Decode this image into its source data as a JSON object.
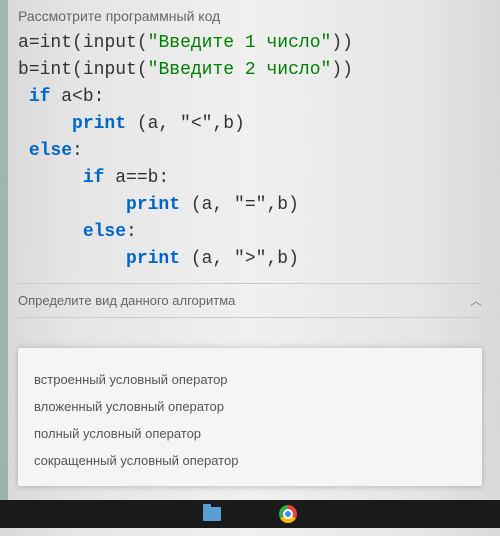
{
  "question": {
    "title": "Рассмотрите программный код",
    "subtitle": "Определите вид данного алгоритма"
  },
  "code": {
    "line1_a": "a",
    "line1_eq": "=",
    "line1_int": "int",
    "line1_p1": "(",
    "line1_input": "input",
    "line1_p2": "(",
    "line1_str": "\"Введите 1 число\"",
    "line1_p3": "))",
    "line2_a": "b",
    "line2_eq": "=",
    "line2_int": "int",
    "line2_p1": "(",
    "line2_input": "input",
    "line2_p2": "(",
    "line2_str": "\"Введите 2 число\"",
    "line2_p3": "))",
    "line3_if": "if",
    "line3_cond": " a<b:",
    "line4_print": "print",
    "line4_args": " (a, \"<\",b)",
    "line5_else": "else",
    "line5_colon": ":",
    "line6_if": "if",
    "line6_cond": " a==b:",
    "line7_print": "print",
    "line7_args": " (a, \"=\",b)",
    "line8_else": "else",
    "line8_colon": ":",
    "line9_print": "print",
    "line9_args": " (a, \">\",b)"
  },
  "options": [
    "встроенный условный оператор",
    "вложенный условный оператор",
    "полный условный оператор",
    "сокращенный условный оператор"
  ]
}
